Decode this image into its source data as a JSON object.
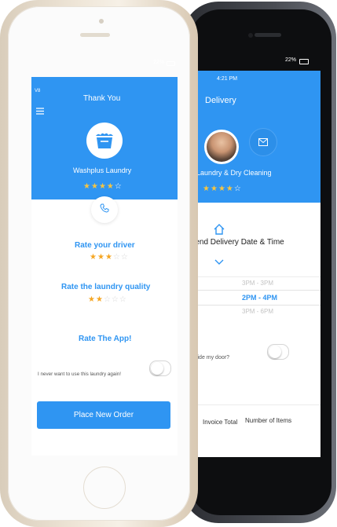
{
  "status": {
    "time": "4:21 PM",
    "carrier": "V8",
    "battery": "22%"
  },
  "front": {
    "title": "Thank You",
    "business_name": "Washplus Laundry",
    "business_rating": 4,
    "rate_driver_label": "Rate your driver",
    "driver_rating": 3,
    "rate_quality_label": "Rate the laundry quality",
    "quality_rating": 2,
    "rate_app_label": "Rate The App!",
    "never_label": "I never want to use this laundry again!",
    "place_order_label": "Place New Order",
    "icons": {
      "menu": "menu-icon",
      "basket": "laundry-basket-icon",
      "phone": "phone-icon"
    }
  },
  "back": {
    "title": "Delivery",
    "business_name": "Laundry & Dry Cleaning",
    "business_rating": 4,
    "recommend_label": "mend Delivery Date & Time",
    "time_slots": [
      "3PM - 3PM",
      "2PM - 4PM",
      "3PM - 6PM"
    ],
    "selected_slot": "2PM - 4PM",
    "door_label": "side my door?",
    "invoice_label": "Invoice Total",
    "items_label": "Number of Items",
    "icons": {
      "mail": "mail-icon",
      "home": "home-icon",
      "chevron": "chevron-down-icon"
    }
  },
  "colors": {
    "accent": "#2f95f2",
    "star": "#f5a623",
    "star_empty": "#d6d6d6"
  }
}
